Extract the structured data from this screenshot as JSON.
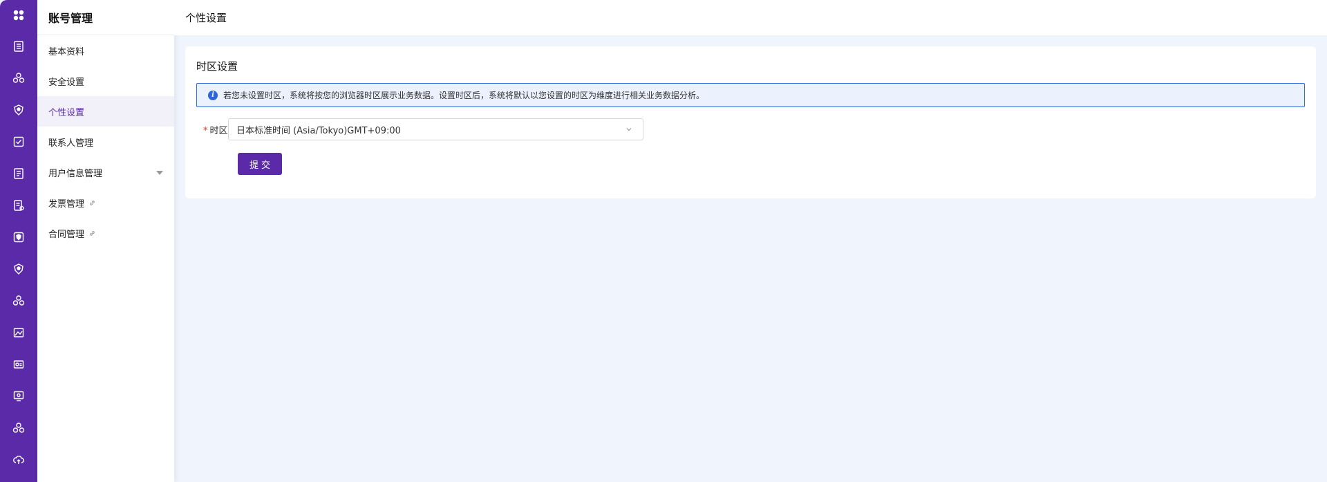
{
  "rail": {
    "icons": [
      "apps-icon",
      "building-icon",
      "cluster-icon",
      "shield-hand-icon",
      "check-square-icon",
      "document-icon",
      "document-gear-icon",
      "badge-icon",
      "shield-hand-icon",
      "cluster-icon",
      "image-icon",
      "id-card-icon",
      "monitor-icon",
      "cluster-icon",
      "cloud-upload-icon"
    ]
  },
  "sidebar": {
    "title": "账号管理",
    "items": [
      {
        "label": "基本资料"
      },
      {
        "label": "安全设置"
      },
      {
        "label": "个性设置",
        "active": true
      },
      {
        "label": "联系人管理"
      },
      {
        "label": "用户信息管理",
        "expandable": true
      },
      {
        "label": "发票管理",
        "external": true
      },
      {
        "label": "合同管理",
        "external": true
      }
    ]
  },
  "header": {
    "title": "个性设置"
  },
  "card": {
    "title": "时区设置",
    "alert": "若您未设置时区，系统将按您的浏览器时区展示业务数据。设置时区后，系统将默认以您设置的时区为维度进行相关业务数据分析。",
    "form": {
      "required_mark": "*",
      "label": "时区",
      "value": "日本标准时间 (Asia/Tokyo)GMT+09:00"
    },
    "submit_label": "提交"
  },
  "colors": {
    "brand": "#5a2aa8",
    "alert_border": "#2f6bd9",
    "alert_bg": "#ecf2fd",
    "page_bg": "#f0f4fc"
  }
}
